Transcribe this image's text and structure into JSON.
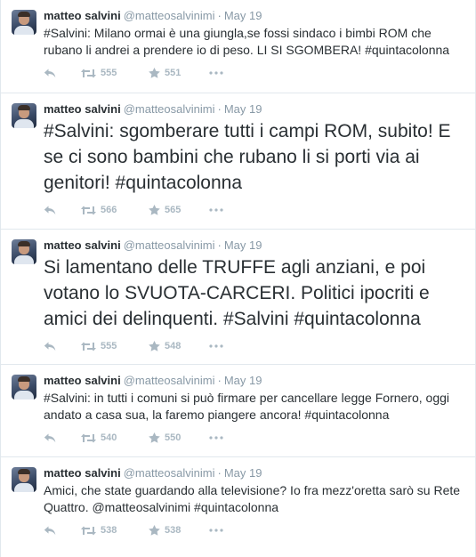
{
  "user": {
    "name": "matteo salvini",
    "handle": "@matteosalvinimi"
  },
  "separator": "·",
  "tweets": [
    {
      "date": "May 19",
      "text": "#Salvini: Milano ormai è una giungla,se fossi sindaco i bimbi ROM che rubano li andrei a prendere io di peso. LI SI SGOMBERA! #quintacolonna",
      "retweets": "555",
      "favorites": "551"
    },
    {
      "date": "May 19",
      "text": "#Salvini: sgomberare tutti i campi ROM, subito! E se ci sono bambini che rubano li si porti via ai genitori! #quintacolonna",
      "retweets": "566",
      "favorites": "565"
    },
    {
      "date": "May 19",
      "text": "Si lamentano delle TRUFFE agli anziani, e poi votano lo SVUOTA-CARCERI. Politici ipocriti e amici dei delinquenti. #Salvini #quintacolonna",
      "retweets": "555",
      "favorites": "548"
    },
    {
      "date": "May 19",
      "text": "#Salvini: in tutti i comuni si può firmare per cancellare legge Fornero, oggi andato a casa sua, la faremo piangere ancora! #quintacolonna",
      "retweets": "540",
      "favorites": "550"
    },
    {
      "date": "May 19",
      "text": "Amici, che state guardando alla televisione? Io fra mezz'oretta sarò su Rete Quattro. @matteosalvinimi #quintacolonna",
      "retweets": "538",
      "favorites": "538"
    }
  ],
  "colors": {
    "text": "#292f33",
    "meta": "#8899a6",
    "action_icons": "#aab8c2",
    "border": "#e1e8ed"
  },
  "icons": [
    "reply-icon",
    "retweet-icon",
    "favorite-star-icon",
    "more-dots-icon"
  ]
}
